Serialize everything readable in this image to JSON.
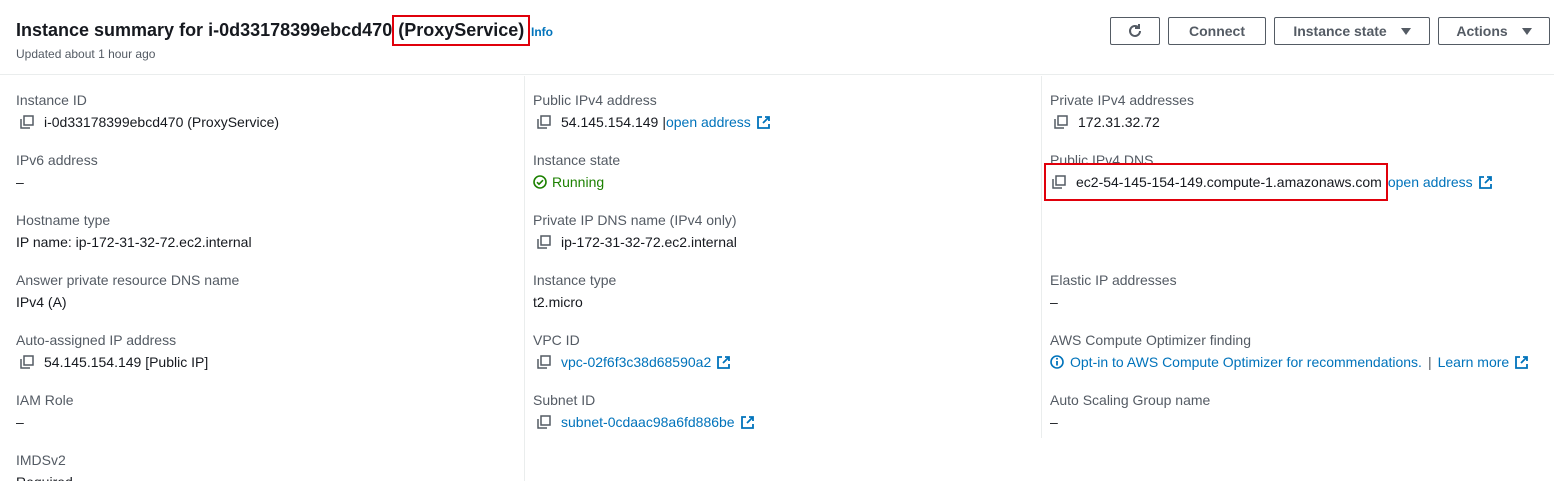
{
  "header": {
    "title_prefix": "Instance summary for i-0d33178399ebcd470 ",
    "title_highlight": "(ProxyService)",
    "info_link": "Info",
    "updated": "Updated about 1 hour ago",
    "buttons": {
      "connect": "Connect",
      "instance_state": "Instance state",
      "actions": "Actions"
    }
  },
  "col1": {
    "instance_id": {
      "label": "Instance ID",
      "value": "i-0d33178399ebcd470 (ProxyService)"
    },
    "ipv6": {
      "label": "IPv6 address",
      "value": "–"
    },
    "hostname_type": {
      "label": "Hostname type",
      "value": "IP name: ip-172-31-32-72.ec2.internal"
    },
    "answer_dns": {
      "label": "Answer private resource DNS name",
      "value": "IPv4 (A)"
    },
    "auto_ip": {
      "label": "Auto-assigned IP address",
      "value": "54.145.154.149 [Public IP]"
    },
    "iam_role": {
      "label": "IAM Role",
      "value": "–"
    },
    "imdsv2": {
      "label": "IMDSv2",
      "value": "Required"
    }
  },
  "col2": {
    "public_ipv4": {
      "label": "Public IPv4 address",
      "value": "54.145.154.149",
      "sep": "|",
      "link": "open address"
    },
    "instance_state": {
      "label": "Instance state",
      "value": "Running"
    },
    "private_dns": {
      "label": "Private IP DNS name (IPv4 only)",
      "value": "ip-172-31-32-72.ec2.internal"
    },
    "instance_type": {
      "label": "Instance type",
      "value": "t2.micro"
    },
    "vpc_id": {
      "label": "VPC ID",
      "value": "vpc-02f6f3c38d68590a2"
    },
    "subnet_id": {
      "label": "Subnet ID",
      "value": "subnet-0cdaac98a6fd886be"
    }
  },
  "col3": {
    "private_ipv4": {
      "label": "Private IPv4 addresses",
      "value": "172.31.32.72"
    },
    "public_dns": {
      "label": "Public IPv4 DNS",
      "value": "ec2-54-145-154-149.compute-1.amazonaws.com",
      "link": "open address"
    },
    "elastic_ip": {
      "label": "Elastic IP addresses",
      "value": "–"
    },
    "optimizer": {
      "label": "AWS Compute Optimizer finding",
      "value": "Opt-in to AWS Compute Optimizer for recommendations.",
      "sep": "|",
      "link": "Learn more"
    },
    "asg": {
      "label": "Auto Scaling Group name",
      "value": "–"
    }
  },
  "colors": {
    "link": "#0073bb",
    "running": "#1d8102",
    "highlight": "#e0000b"
  }
}
